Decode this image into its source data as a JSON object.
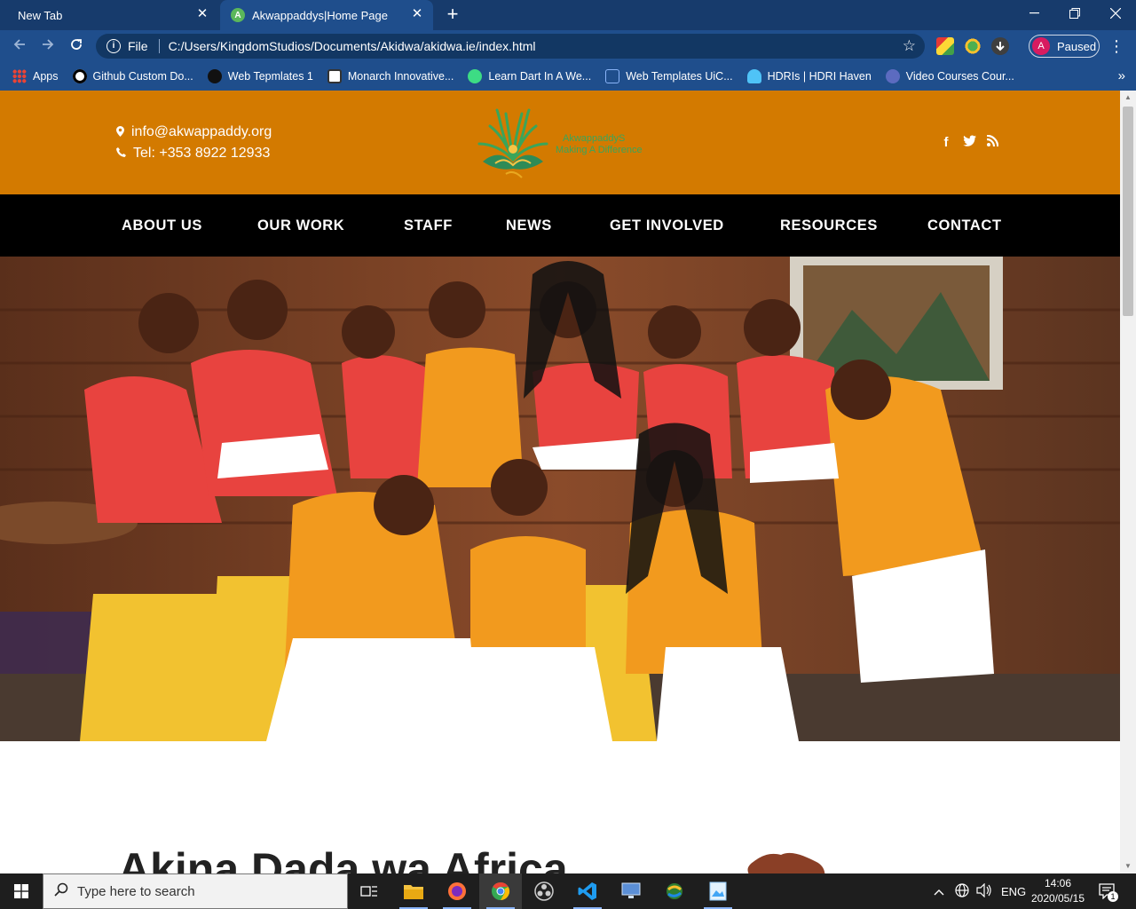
{
  "browser": {
    "tabs": [
      {
        "title": "New Tab",
        "active": false
      },
      {
        "title": "Akwappaddys|Home Page",
        "active": true,
        "favicon_letter": "A"
      }
    ],
    "address": {
      "scheme": "File",
      "url": "C:/Users/KingdomStudios/Documents/Akidwa/akidwa.ie/index.html"
    },
    "profile": {
      "initial": "A",
      "status": "Paused"
    },
    "bookmarks": [
      {
        "label": "Apps",
        "icon": "apps-grid-icon"
      },
      {
        "label": "Github Custom Do...",
        "icon": "github-icon"
      },
      {
        "label": "Web Tepmlates 1",
        "icon": "bird-icon"
      },
      {
        "label": "Monarch Innovative...",
        "icon": "monarch-icon"
      },
      {
        "label": "Learn Dart In A We...",
        "icon": "android-icon"
      },
      {
        "label": "Web Templates UiC...",
        "icon": "template-icon"
      },
      {
        "label": "HDRIs | HDRI Haven",
        "icon": "hdri-icon"
      },
      {
        "label": "Video Courses Cour...",
        "icon": "course-icon"
      }
    ],
    "colors": {
      "titlebar": "#173b6c",
      "toolbar": "#1f4e8c"
    }
  },
  "site": {
    "header": {
      "email": "info@akwappaddy.org",
      "phone": "Tel: +353 8922 12933",
      "logo_name": "AkwappaddyS",
      "logo_tagline": "Making A Difference",
      "social": [
        "facebook-icon",
        "twitter-icon",
        "rss-icon"
      ]
    },
    "nav": [
      "ABOUT US",
      "OUR WORK",
      "STAFF",
      "NEWS",
      "GET INVOLVED",
      "RESOURCES",
      "CONTACT"
    ],
    "intro_title": "Akina Dada wa Africa",
    "colors": {
      "topbar": "#d37a00",
      "nav": "#000000",
      "logo_green": "#3aa55a"
    }
  },
  "taskbar": {
    "search_placeholder": "Type here to search",
    "language": "ENG",
    "time": "14:06",
    "date": "2020/05/15",
    "notification_count": "1"
  }
}
